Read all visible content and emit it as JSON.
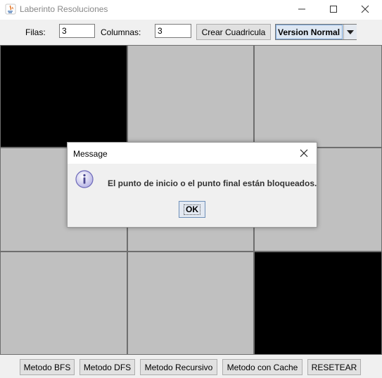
{
  "window": {
    "title": "Laberinto Resoluciones",
    "icons": [
      "java-app-icon",
      "minimize-icon",
      "maximize-icon",
      "close-icon"
    ]
  },
  "toolbar": {
    "rows_label": "Filas:",
    "rows_value": "3",
    "cols_label": "Columnas:",
    "cols_value": "3",
    "create_button": "Crear Cuadricula",
    "version_selected": "Version Normal"
  },
  "grid": {
    "rows": 3,
    "cols": 3,
    "cells": [
      [
        "blocked",
        "open",
        "open"
      ],
      [
        "open",
        "open",
        "open"
      ],
      [
        "open",
        "open",
        "blocked"
      ]
    ],
    "colors": {
      "blocked": "#000000",
      "open": "#c0c0c0"
    }
  },
  "buttons": {
    "bfs": "Metodo BFS",
    "dfs": "Metodo DFS",
    "recursive": "Metodo Recursivo",
    "cache": "Metodo con Cache",
    "reset": "RESETEAR"
  },
  "dialog": {
    "title": "Message",
    "message": "El punto de inicio o el punto final están bloqueados.",
    "ok_label": "OK",
    "icon": "info-icon"
  }
}
